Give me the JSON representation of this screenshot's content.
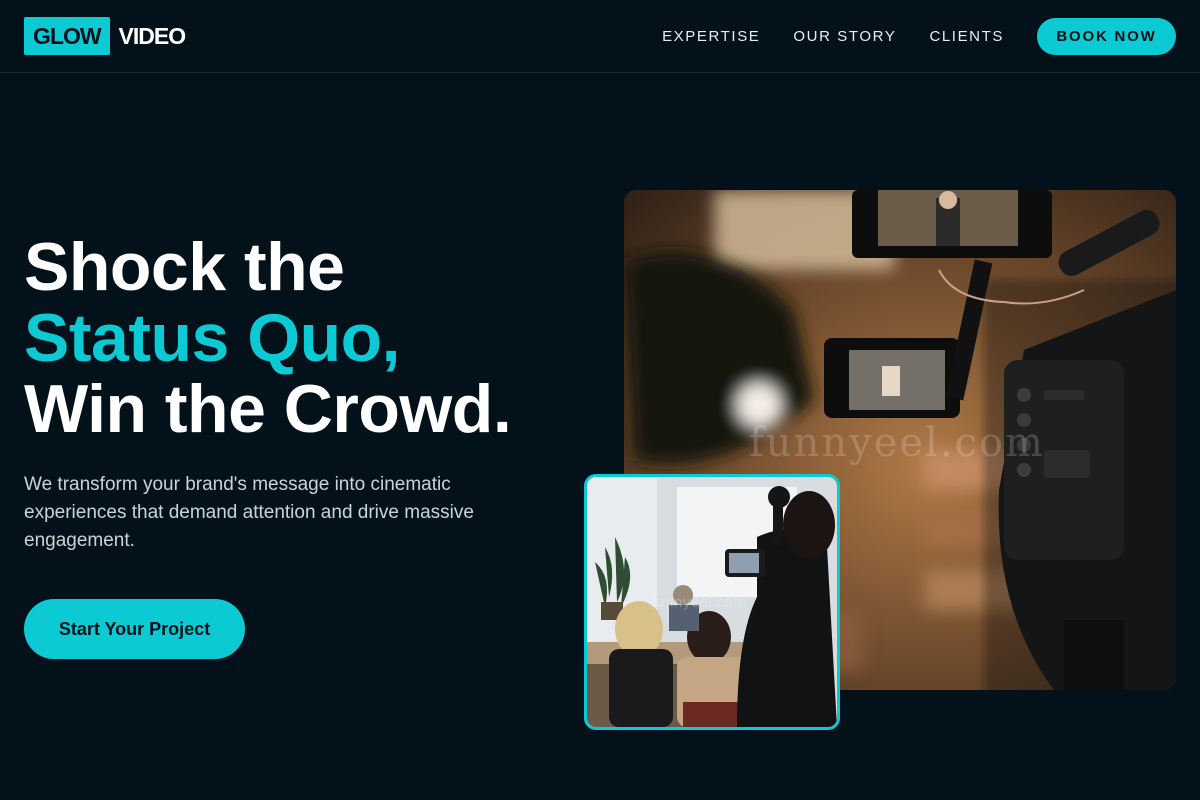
{
  "brand": {
    "logo_box_text": "GLOW",
    "logo_text": "VIDEO",
    "accent_color": "#0ccad3",
    "background_color": "#03121a"
  },
  "nav": {
    "items": [
      {
        "label": "EXPERTISE"
      },
      {
        "label": "OUR STORY"
      },
      {
        "label": "CLIENTS"
      }
    ],
    "cta_label": "BOOK NOW"
  },
  "hero": {
    "headline_line1": "Shock the",
    "headline_line2": "Status Quo,",
    "headline_line3": "Win the Crowd.",
    "subtext": "We transform your brand's message into cinematic experiences that demand attention and drive massive engagement.",
    "cta_label": "Start Your Project"
  },
  "images": {
    "main_photo_watermark": "funnyeel.com",
    "small_photo_watermark": "funnyeel.com"
  }
}
